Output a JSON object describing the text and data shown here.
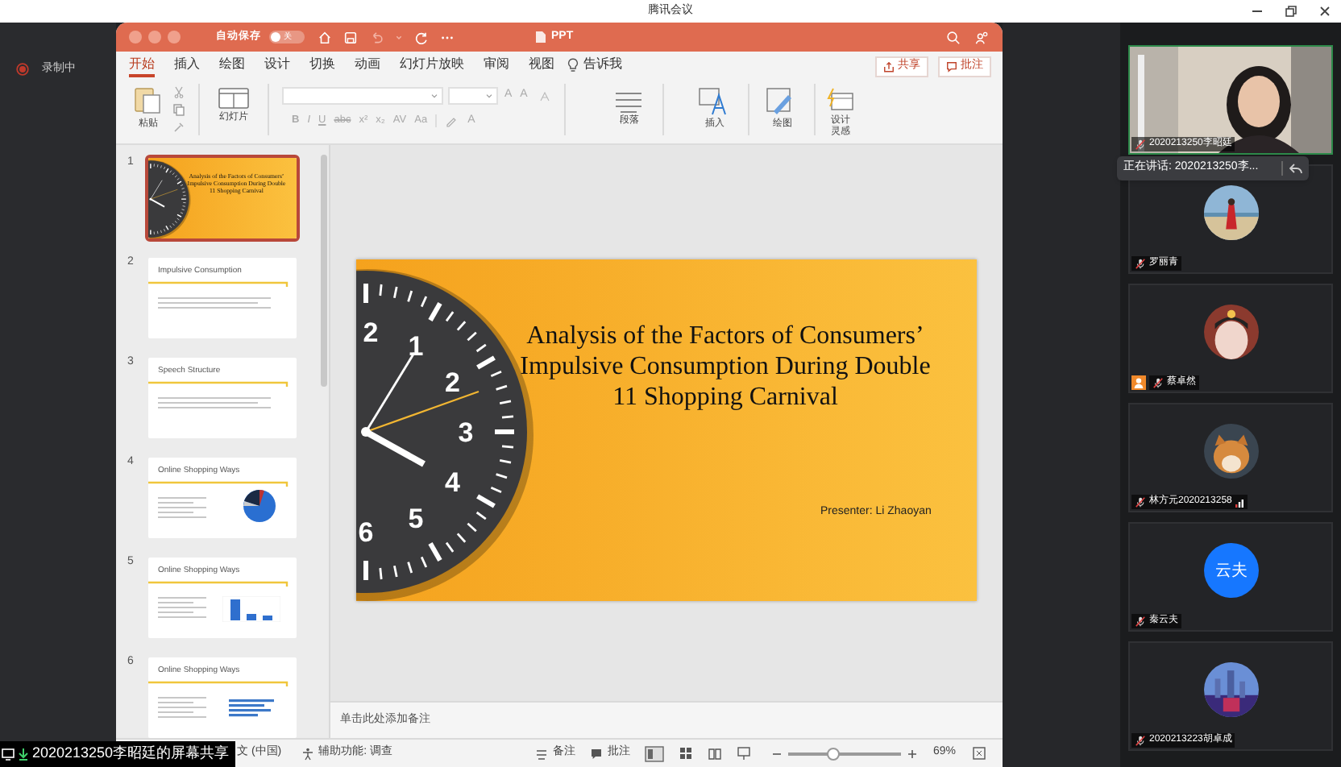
{
  "app_title": "腾讯会议",
  "recording": {
    "label": "录制中"
  },
  "ppt": {
    "autosave_label": "自动保存",
    "autosave_on": false,
    "autosave_state": "关",
    "doc_title": "PPT",
    "tabs": [
      {
        "label": "开始",
        "selected": true
      },
      {
        "label": "插入",
        "selected": false
      },
      {
        "label": "绘图",
        "selected": false
      },
      {
        "label": "设计",
        "selected": false
      },
      {
        "label": "切换",
        "selected": false
      },
      {
        "label": "动画",
        "selected": false
      },
      {
        "label": "幻灯片放映",
        "selected": false
      },
      {
        "label": "审阅",
        "selected": false
      },
      {
        "label": "视图",
        "selected": false
      }
    ],
    "tell_me": "告诉我",
    "share_button": "共享",
    "comments_button": "批注",
    "toolbar": {
      "paste": "粘贴",
      "slides": "幻灯片",
      "size_buttons": [
        "A",
        "A"
      ],
      "format_buttons": [
        "B",
        "I",
        "U",
        "abc",
        "x²",
        "x₂",
        "AV",
        "Aa"
      ],
      "color_button": "A",
      "paragraph": "段落",
      "insert": "插入",
      "draw": "绘图",
      "designer": "设计灵感"
    },
    "thumbnails": [
      {
        "number": "1",
        "kind": "title",
        "selected": true,
        "title": "Analysis of the Factors of Consumers’ Impulsive Consumption During Double 11 Shopping Carnival"
      },
      {
        "number": "2",
        "kind": "bullets",
        "selected": false,
        "title": "Impulsive Consumption"
      },
      {
        "number": "3",
        "kind": "bullets",
        "selected": false,
        "title": "Speech Structure"
      },
      {
        "number": "4",
        "kind": "pie",
        "selected": false,
        "title": "Online Shopping Ways"
      },
      {
        "number": "5",
        "kind": "bars",
        "selected": false,
        "title": "Online Shopping Ways"
      },
      {
        "number": "6",
        "kind": "hbars",
        "selected": false,
        "title": "Online Shopping Ways"
      }
    ],
    "slide": {
      "title": "Analysis of the Factors of Consumers’ Impulsive Consumption During Double 11 Shopping Carnival",
      "presenter": "Presenter: Li Zhaoyan",
      "clock_numbers": [
        "2",
        "1",
        "2",
        "3",
        "4",
        "5",
        "6"
      ]
    },
    "notes_placeholder": "单击此处添加备注",
    "status": {
      "language": "文 (中国)",
      "accessibility": "辅助功能: 调查",
      "notes": "备注",
      "comments": "批注",
      "zoom_slider": {
        "level": 0.4
      },
      "zoom": "69%"
    }
  },
  "share_banner": "2020213250李昭廷的屏幕共享",
  "speaking": "正在讲话: 2020213250李...",
  "participants": [
    {
      "name": "2020213250李昭廷",
      "kind": "video",
      "host": false,
      "signal": false
    },
    {
      "name": "罗丽青",
      "kind": "picture",
      "host": false,
      "signal": false
    },
    {
      "name": "蔡卓然",
      "kind": "picture",
      "host": true,
      "signal": false
    },
    {
      "name": "林方元2020213258",
      "kind": "picture",
      "host": false,
      "signal": true
    },
    {
      "name": "秦云夫",
      "kind": "initials",
      "initials": "云夫",
      "host": false,
      "signal": false
    },
    {
      "name": "2020213223胡卓成",
      "kind": "picture",
      "host": false,
      "signal": false
    }
  ]
}
